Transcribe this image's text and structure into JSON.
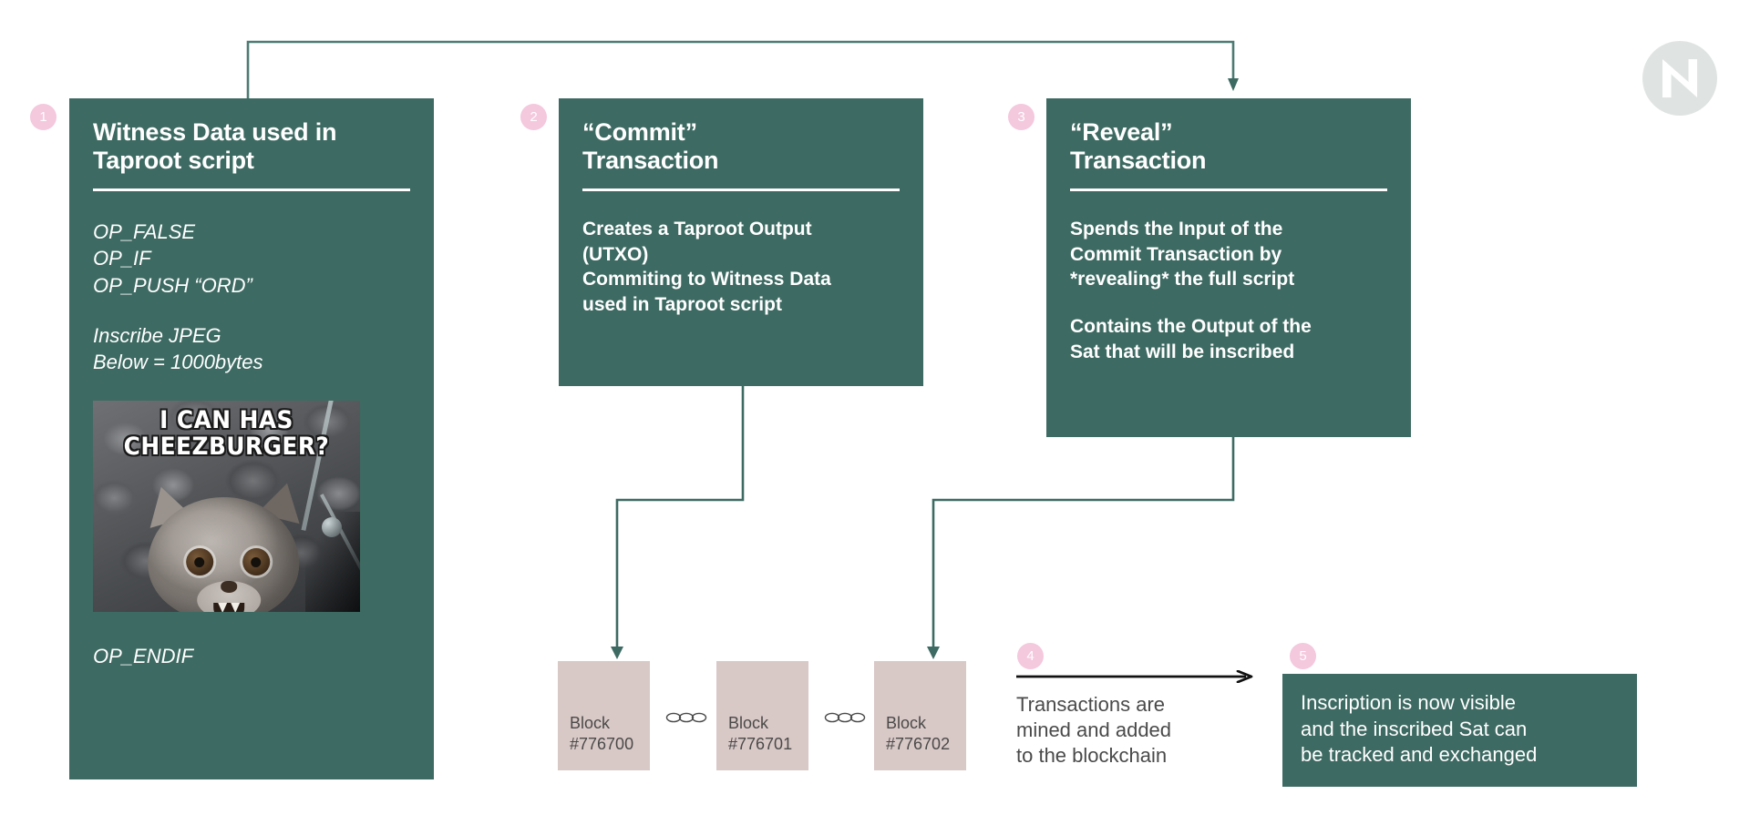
{
  "cards": {
    "witness": {
      "step": "1",
      "title": "Witness Data used in\nTaproot script",
      "script_block_1": "OP_FALSE\nOP_IF\nOP_PUSH “ORD”",
      "script_block_2": "Inscribe JPEG\nBelow = 1000bytes",
      "script_block_3": "OP_ENDIF",
      "meme_caption": "I CAN HAS\nCHEEZBURGER?"
    },
    "commit": {
      "step": "2",
      "title": "“Commit”\nTransaction",
      "body": "Creates a Taproot Output\n(UTXO)\nCommiting to Witness Data\nused in Taproot script"
    },
    "reveal": {
      "step": "3",
      "title": "“Reveal”\nTransaction",
      "body_1": "Spends the Input of the\nCommit Transaction by\n*revealing* the full script",
      "body_2": "Contains the Output of the\nSat that will be inscribed"
    },
    "mined": {
      "step": "4",
      "text": "Transactions are\nmined and added\nto the blockchain"
    },
    "inscription": {
      "step": "5",
      "text": "Inscription is now visible\nand the inscribed Sat can\nbe tracked and exchanged"
    }
  },
  "blocks": [
    {
      "label": "Block\n#776700"
    },
    {
      "label": "Block\n#776701"
    },
    {
      "label": "Block\n#776702"
    }
  ],
  "icons": {
    "chain_link": "chain-link-icon",
    "logo": "brand-n-logo-icon",
    "arrow_down": "arrow-down-icon",
    "arrow_right": "arrow-right-icon"
  },
  "colors": {
    "card_green": "#3d6a62",
    "badge_pink": "#f4c8dd",
    "block_mauve": "#d8c8c6",
    "connector_green": "#4c7a72",
    "logo_grey": "#dfe4e3",
    "background": "#ffffff",
    "text_dark": "#4a4a4a"
  }
}
